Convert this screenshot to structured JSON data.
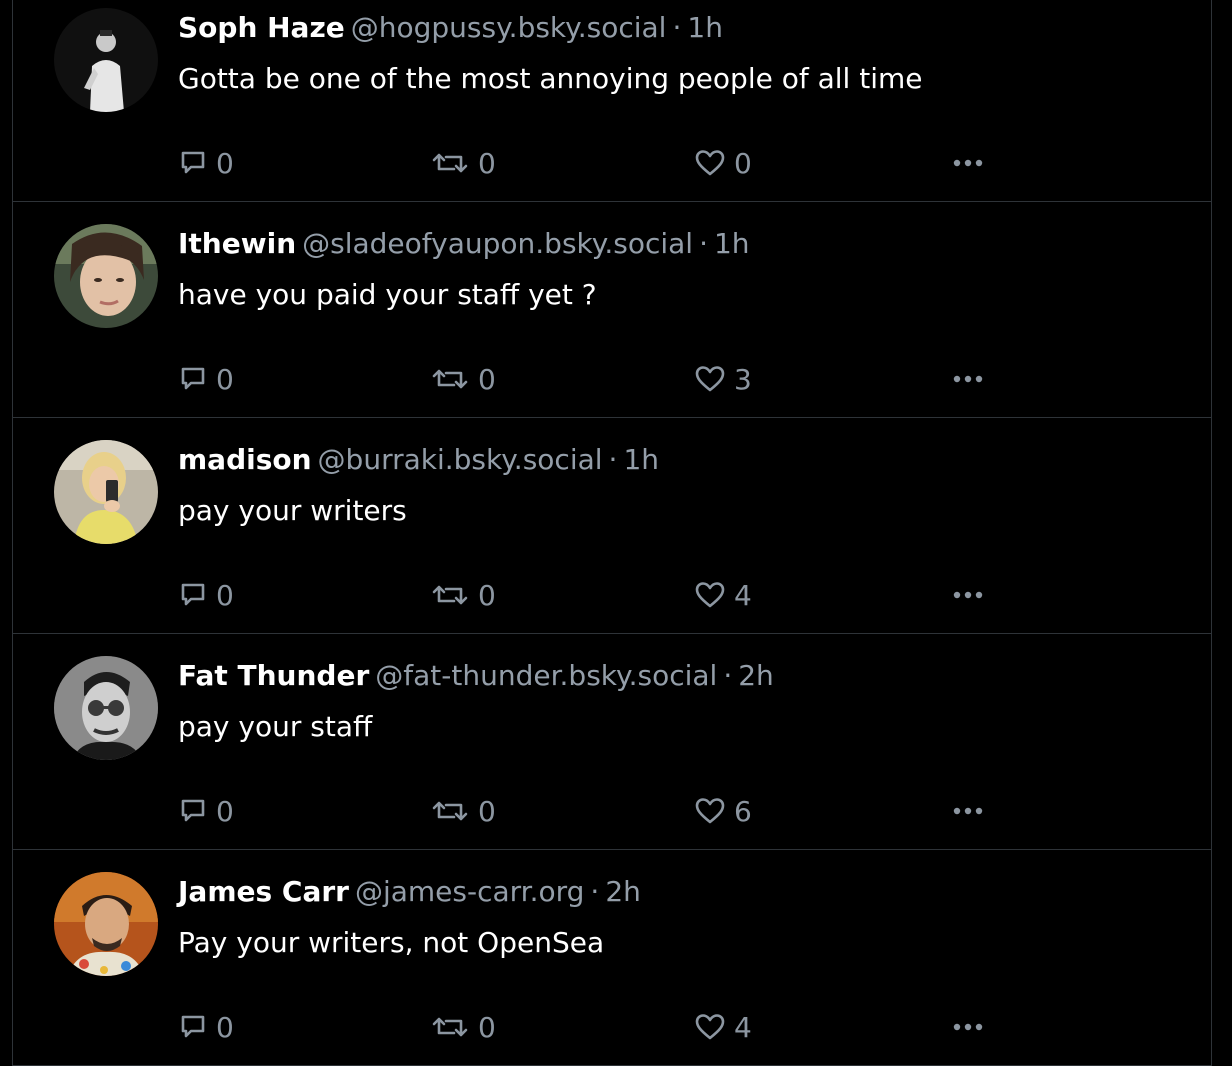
{
  "colors": {
    "background": "#000000",
    "divider": "#2e3338",
    "text_primary": "#ffffff",
    "text_secondary": "#949ea9",
    "icon": "#8c96a1"
  },
  "icons": {
    "reply": "speech-bubble-icon",
    "repost": "repost-arrows-icon",
    "like": "heart-outline-icon",
    "more": "ellipsis-horizontal-icon"
  },
  "posts": [
    {
      "name": "Soph Haze",
      "handle": "@hogpussy.bsky.social",
      "separator": "·",
      "time": "1h",
      "text": "Gotta be one of the most annoying people of all time",
      "replies": "0",
      "reposts": "0",
      "likes": "0"
    },
    {
      "name": "Ithewin",
      "handle": "@sladeofyaupon.bsky.social",
      "separator": "·",
      "time": "1h",
      "text": "have you paid your staff yet ?",
      "replies": "0",
      "reposts": "0",
      "likes": "3"
    },
    {
      "name": "madison",
      "handle": "@burraki.bsky.social",
      "separator": "·",
      "time": "1h",
      "text": "pay your writers",
      "replies": "0",
      "reposts": "0",
      "likes": "4"
    },
    {
      "name": "Fat Thunder",
      "handle": "@fat-thunder.bsky.social",
      "separator": "·",
      "time": "2h",
      "text": "pay your staff",
      "replies": "0",
      "reposts": "0",
      "likes": "6"
    },
    {
      "name": "James Carr",
      "handle": "@james-carr.org",
      "separator": "·",
      "time": "2h",
      "text": "Pay your writers, not OpenSea",
      "replies": "0",
      "reposts": "0",
      "likes": "4"
    }
  ]
}
